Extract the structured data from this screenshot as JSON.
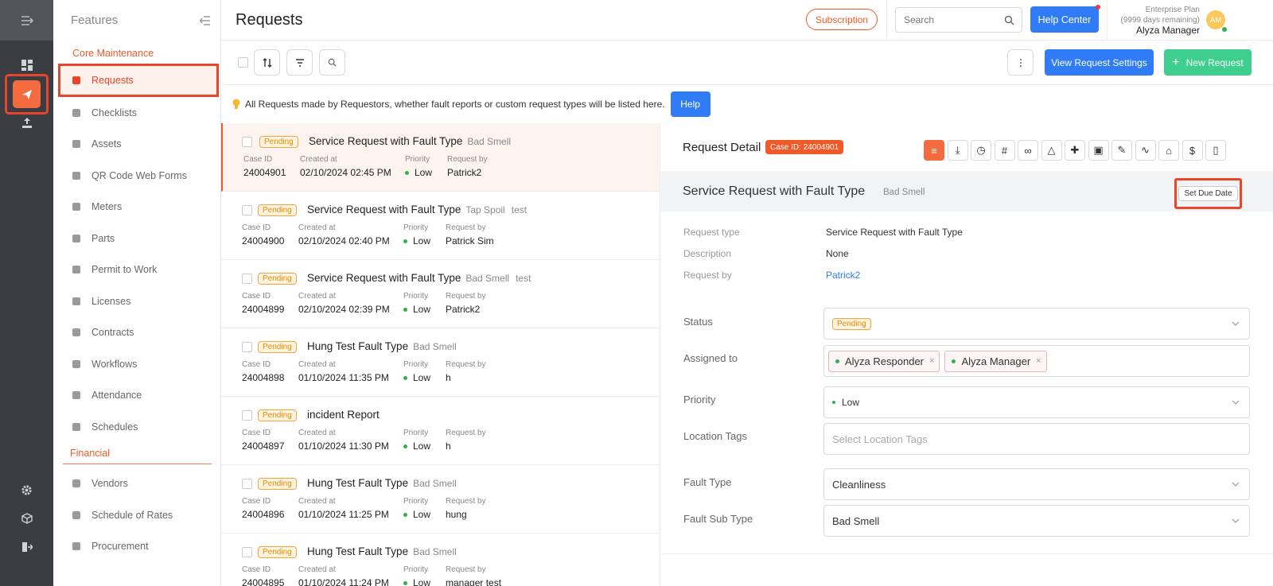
{
  "rail": {
    "items": [
      "menu-toggle-icon",
      "dashboard-icon",
      "requests-icon",
      "reports-icon",
      "settings-icon",
      "cube-icon",
      "logout-icon"
    ]
  },
  "sidebar": {
    "title": "Features",
    "section_core": "Core Maintenance",
    "items_core": [
      {
        "label": "Requests",
        "icon": "request-icon"
      },
      {
        "label": "Checklists",
        "icon": "checklist-icon"
      },
      {
        "label": "Assets",
        "icon": "asset-icon"
      },
      {
        "label": "QR Code Web Forms",
        "icon": "qr-icon"
      },
      {
        "label": "Meters",
        "icon": "meter-icon"
      },
      {
        "label": "Parts",
        "icon": "parts-icon"
      },
      {
        "label": "Permit to Work",
        "icon": "permit-icon"
      },
      {
        "label": "Licenses",
        "icon": "license-icon"
      },
      {
        "label": "Contracts",
        "icon": "contract-icon"
      },
      {
        "label": "Workflows",
        "icon": "workflow-icon"
      },
      {
        "label": "Attendance",
        "icon": "attendance-icon"
      },
      {
        "label": "Schedules",
        "icon": "calendar-icon"
      }
    ],
    "section_financial": "Financial",
    "items_financial": [
      {
        "label": "Vendors",
        "icon": "vendor-icon"
      },
      {
        "label": "Schedule of Rates",
        "icon": "dollar-icon"
      },
      {
        "label": "Procurement",
        "icon": "procurement-icon"
      }
    ]
  },
  "header": {
    "title": "Requests",
    "subscription": "Subscription",
    "search_placeholder": "Search",
    "help_center": "Help Center",
    "plan": "Enterprise Plan",
    "days": "(9999 days remaining)",
    "user": "Alyza Manager",
    "avatar": "AM"
  },
  "toolbar": {
    "view_settings": "View Request Settings",
    "new_request": "New Request"
  },
  "info": {
    "text": "All Requests made by Requestors, whether fault reports or custom request types will be listed here.",
    "help": "Help"
  },
  "list": {
    "labels": {
      "case": "Case ID",
      "created": "Created at",
      "priority": "Priority",
      "by": "Request by"
    },
    "rows": [
      {
        "status": "Pending",
        "title": "Service Request with Fault Type",
        "sub": "Bad Smell",
        "sub2": "",
        "case": "24004901",
        "created": "02/10/2024 02:45 PM",
        "priority": "Low",
        "by": "Patrick2"
      },
      {
        "status": "Pending",
        "title": "Service Request with Fault Type",
        "sub": "Tap Spoil",
        "sub2": "test",
        "case": "24004900",
        "created": "02/10/2024 02:40 PM",
        "priority": "Low",
        "by": "Patrick Sim"
      },
      {
        "status": "Pending",
        "title": "Service Request with Fault Type",
        "sub": "Bad Smell",
        "sub2": "test",
        "case": "24004899",
        "created": "02/10/2024 02:39 PM",
        "priority": "Low",
        "by": "Patrick2"
      },
      {
        "status": "Pending",
        "title": "Hung Test Fault Type",
        "sub": "Bad Smell",
        "sub2": "",
        "case": "24004898",
        "created": "01/10/2024 11:35 PM",
        "priority": "Low",
        "by": "h"
      },
      {
        "status": "Pending",
        "title": "incident Report",
        "sub": "",
        "sub2": "",
        "case": "24004897",
        "created": "01/10/2024 11:30 PM",
        "priority": "Low",
        "by": "h"
      },
      {
        "status": "Pending",
        "title": "Hung Test Fault Type",
        "sub": "Bad Smell",
        "sub2": "",
        "case": "24004896",
        "created": "01/10/2024 11:25 PM",
        "priority": "Low",
        "by": "hung"
      },
      {
        "status": "Pending",
        "title": "Hung Test Fault Type",
        "sub": "Bad Smell",
        "sub2": "",
        "case": "24004895",
        "created": "01/10/2024 11:24 PM",
        "priority": "Low",
        "by": "manager test"
      }
    ]
  },
  "detail": {
    "heading": "Request Detail",
    "case_badge": "Case ID: 24004901",
    "title": "Service Request with Fault Type",
    "subtitle": "Bad Smell",
    "set_due": "Set Due Date",
    "fields": [
      {
        "label": "Request type",
        "value": "Service Request with Fault Type"
      },
      {
        "label": "Description",
        "value": "None"
      },
      {
        "label": "Request by",
        "value": "Patrick2"
      }
    ],
    "status_label": "Status",
    "status_value": "Pending",
    "assigned_label": "Assigned to",
    "assignees": [
      "Alyza Responder",
      "Alyza Manager"
    ],
    "priority_label": "Priority",
    "priority_value": "Low",
    "location_label": "Location Tags",
    "location_placeholder": "Select Location Tags",
    "fault_label": "Fault Type",
    "fault_value": "Cleanliness",
    "subtype_label": "Fault Sub Type",
    "subtype_value": "Bad Smell"
  },
  "colors": {
    "accent": "#f05a28",
    "blue": "#2f7cf6",
    "green": "#3ecf8e",
    "rail": "#3a3d42"
  }
}
